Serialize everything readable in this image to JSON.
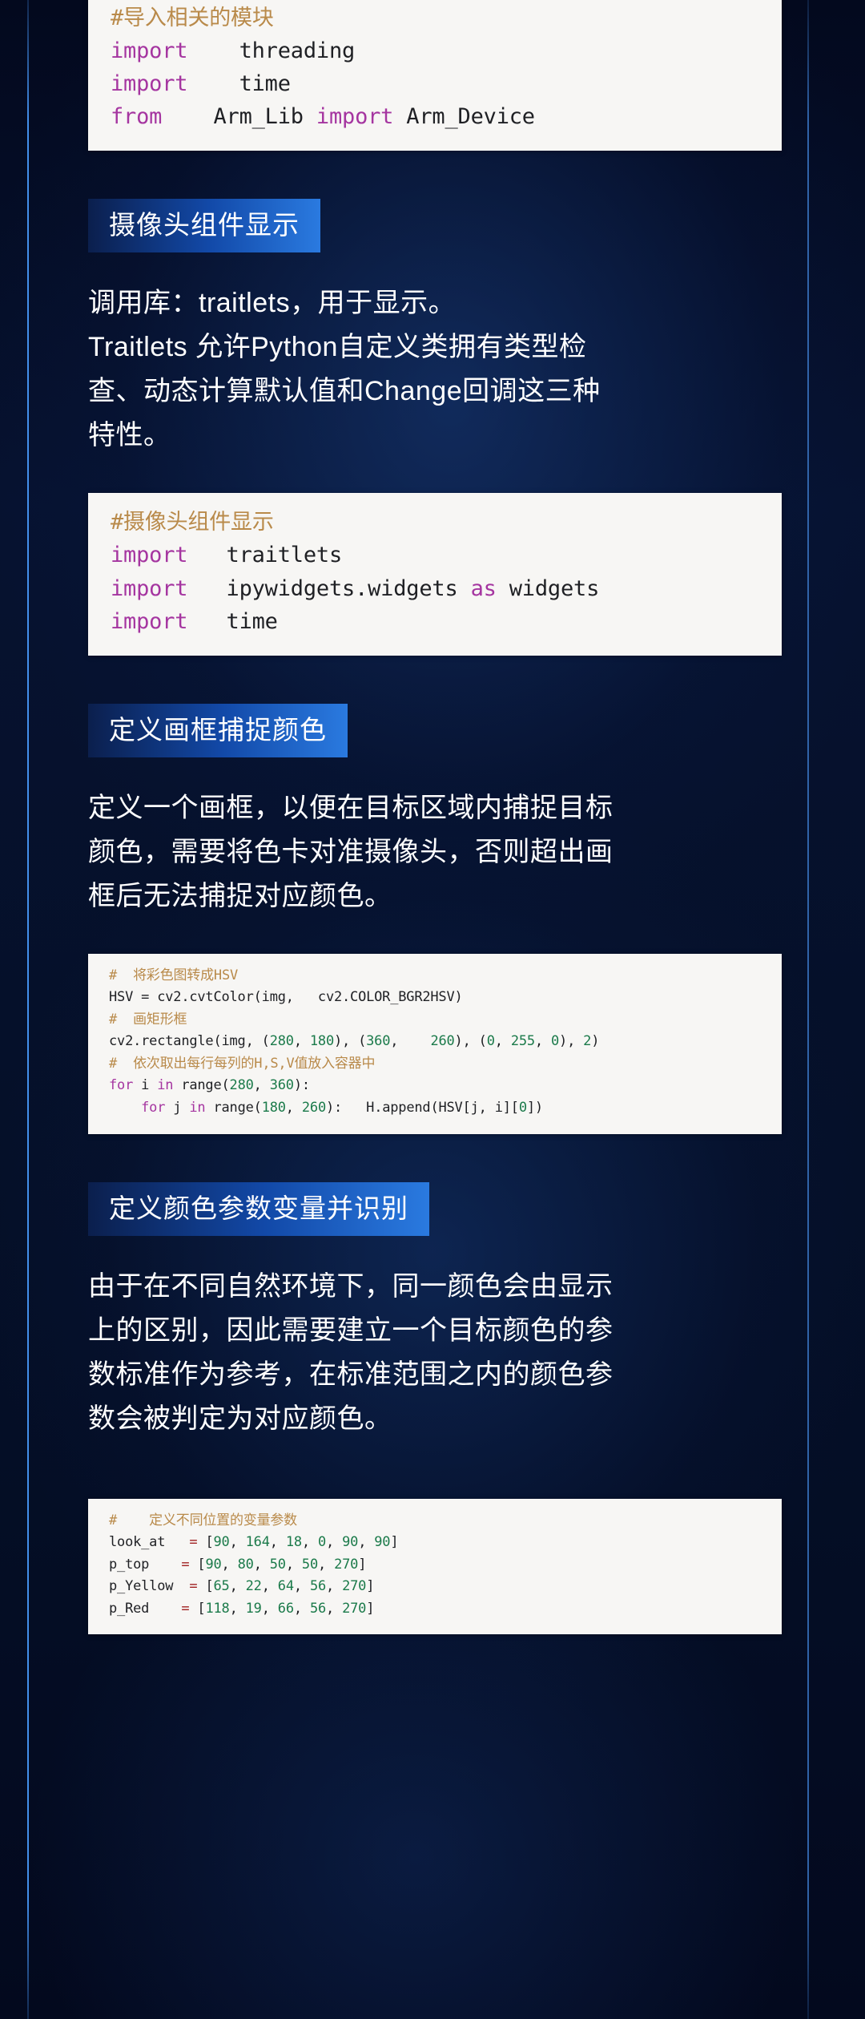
{
  "theme": {
    "page_bg": "#040d26",
    "rule_color": "#4696f5",
    "code_bg": "#f7f6f4",
    "header_gradient_start": "#0b1f4d",
    "header_gradient_end": "#2a7ae0",
    "text_color": "#ffffff",
    "comment_color": "#b98a4a",
    "keyword_color": "#a535a0",
    "number_color": "#1b7a4a",
    "operator_color": "#a02020"
  },
  "blocks": {
    "code_imports": {
      "lines": [
        {
          "parts": [
            {
              "t": "#导入相关的模块",
              "c": "cmt"
            }
          ]
        },
        {
          "parts": [
            {
              "t": "import",
              "c": "kw"
            },
            {
              "t": "    threading",
              "c": "txt"
            }
          ]
        },
        {
          "parts": [
            {
              "t": "import",
              "c": "kw"
            },
            {
              "t": "    time",
              "c": "txt"
            }
          ]
        },
        {
          "parts": [
            {
              "t": "from",
              "c": "kw"
            },
            {
              "t": "    Arm_Lib ",
              "c": "txt"
            },
            {
              "t": "import",
              "c": "kw"
            },
            {
              "t": " Arm_Device",
              "c": "txt"
            }
          ]
        }
      ]
    },
    "section_camera": {
      "heading": "摄像头组件显示",
      "paragraph": [
        "调用库：traitlets，用于显示。",
        "Traitlets 允许Python自定义类拥有类型检",
        "查、动态计算默认值和Change回调这三种",
        "特性。"
      ],
      "code": {
        "lines": [
          {
            "parts": [
              {
                "t": "#摄像头组件显示",
                "c": "cmt"
              }
            ]
          },
          {
            "parts": [
              {
                "t": "import",
                "c": "kw"
              },
              {
                "t": "   traitlets",
                "c": "txt"
              }
            ]
          },
          {
            "parts": [
              {
                "t": "import",
                "c": "kw"
              },
              {
                "t": "   ipywidgets.widgets ",
                "c": "txt"
              },
              {
                "t": "as",
                "c": "kw"
              },
              {
                "t": " widgets",
                "c": "txt"
              }
            ]
          },
          {
            "parts": [
              {
                "t": "import",
                "c": "kw"
              },
              {
                "t": "   time",
                "c": "txt"
              }
            ]
          }
        ]
      }
    },
    "section_frame": {
      "heading": "定义画框捕捉颜色",
      "paragraph": [
        "定义一个画框，以便在目标区域内捕捉目标",
        "颜色，需要将色卡对准摄像头，否则超出画",
        "框后无法捕捉对应颜色。"
      ],
      "code": {
        "lines": [
          {
            "parts": [
              {
                "t": "#  将彩色图转成HSV",
                "c": "cmt"
              }
            ]
          },
          {
            "parts": [
              {
                "t": "HSV = cv2.cvtColor(img,   cv2.COLOR_BGR2HSV)",
                "c": "txt"
              }
            ]
          },
          {
            "parts": [
              {
                "t": "#  画矩形框",
                "c": "cmt"
              }
            ]
          },
          {
            "parts": [
              {
                "t": "cv2.rectangle(img, (",
                "c": "txt"
              },
              {
                "t": "280",
                "c": "num"
              },
              {
                "t": ", ",
                "c": "txt"
              },
              {
                "t": "180",
                "c": "num"
              },
              {
                "t": "), (",
                "c": "txt"
              },
              {
                "t": "360",
                "c": "num"
              },
              {
                "t": ",    ",
                "c": "txt"
              },
              {
                "t": "260",
                "c": "num"
              },
              {
                "t": "), (",
                "c": "txt"
              },
              {
                "t": "0",
                "c": "num"
              },
              {
                "t": ", ",
                "c": "txt"
              },
              {
                "t": "255",
                "c": "num"
              },
              {
                "t": ", ",
                "c": "txt"
              },
              {
                "t": "0",
                "c": "num"
              },
              {
                "t": "), ",
                "c": "txt"
              },
              {
                "t": "2",
                "c": "num"
              },
              {
                "t": ")",
                "c": "txt"
              }
            ]
          },
          {
            "parts": [
              {
                "t": "#  依次取出每行每列的H,S,V值放入容器中",
                "c": "cmt"
              }
            ]
          },
          {
            "parts": [
              {
                "t": "for",
                "c": "kw"
              },
              {
                "t": " i ",
                "c": "txt"
              },
              {
                "t": "in",
                "c": "kw"
              },
              {
                "t": " range(",
                "c": "txt"
              },
              {
                "t": "280",
                "c": "num"
              },
              {
                "t": ", ",
                "c": "txt"
              },
              {
                "t": "360",
                "c": "num"
              },
              {
                "t": "):",
                "c": "txt"
              }
            ]
          },
          {
            "parts": [
              {
                "t": "    ",
                "c": "txt"
              },
              {
                "t": "for",
                "c": "kw"
              },
              {
                "t": " j ",
                "c": "txt"
              },
              {
                "t": "in",
                "c": "kw"
              },
              {
                "t": " range(",
                "c": "txt"
              },
              {
                "t": "180",
                "c": "num"
              },
              {
                "t": ", ",
                "c": "txt"
              },
              {
                "t": "260",
                "c": "num"
              },
              {
                "t": "):   H.append(HSV[j, i][",
                "c": "txt"
              },
              {
                "t": "0",
                "c": "num"
              },
              {
                "t": "])",
                "c": "txt"
              }
            ]
          }
        ]
      }
    },
    "section_color_params": {
      "heading": "定义颜色参数变量并识别",
      "paragraph": [
        "由于在不同自然环境下，同一颜色会由显示",
        "上的区别，因此需要建立一个目标颜色的参",
        "数标准作为参考，在标准范围之内的颜色参",
        "数会被判定为对应颜色。"
      ],
      "code": {
        "lines": [
          {
            "parts": [
              {
                "t": "#    定义不同位置的变量参数",
                "c": "cmt"
              }
            ]
          },
          {
            "parts": [
              {
                "t": "look_at   ",
                "c": "txt"
              },
              {
                "t": "=",
                "c": "op"
              },
              {
                "t": " [",
                "c": "txt"
              },
              {
                "t": "90",
                "c": "num"
              },
              {
                "t": ", ",
                "c": "txt"
              },
              {
                "t": "164",
                "c": "num"
              },
              {
                "t": ", ",
                "c": "txt"
              },
              {
                "t": "18",
                "c": "num"
              },
              {
                "t": ", ",
                "c": "txt"
              },
              {
                "t": "0",
                "c": "num"
              },
              {
                "t": ", ",
                "c": "txt"
              },
              {
                "t": "90",
                "c": "num"
              },
              {
                "t": ", ",
                "c": "txt"
              },
              {
                "t": "90",
                "c": "num"
              },
              {
                "t": "]",
                "c": "txt"
              }
            ]
          },
          {
            "parts": [
              {
                "t": "p_top    ",
                "c": "txt"
              },
              {
                "t": "=",
                "c": "op"
              },
              {
                "t": " [",
                "c": "txt"
              },
              {
                "t": "90",
                "c": "num"
              },
              {
                "t": ", ",
                "c": "txt"
              },
              {
                "t": "80",
                "c": "num"
              },
              {
                "t": ", ",
                "c": "txt"
              },
              {
                "t": "50",
                "c": "num"
              },
              {
                "t": ", ",
                "c": "txt"
              },
              {
                "t": "50",
                "c": "num"
              },
              {
                "t": ", ",
                "c": "txt"
              },
              {
                "t": "270",
                "c": "num"
              },
              {
                "t": "]",
                "c": "txt"
              }
            ]
          },
          {
            "parts": [
              {
                "t": "p_Yellow  ",
                "c": "txt"
              },
              {
                "t": "=",
                "c": "op"
              },
              {
                "t": " [",
                "c": "txt"
              },
              {
                "t": "65",
                "c": "num"
              },
              {
                "t": ", ",
                "c": "txt"
              },
              {
                "t": "22",
                "c": "num"
              },
              {
                "t": ", ",
                "c": "txt"
              },
              {
                "t": "64",
                "c": "num"
              },
              {
                "t": ", ",
                "c": "txt"
              },
              {
                "t": "56",
                "c": "num"
              },
              {
                "t": ", ",
                "c": "txt"
              },
              {
                "t": "270",
                "c": "num"
              },
              {
                "t": "]",
                "c": "txt"
              }
            ]
          },
          {
            "parts": [
              {
                "t": "p_Red    ",
                "c": "txt"
              },
              {
                "t": "=",
                "c": "op"
              },
              {
                "t": " [",
                "c": "txt"
              },
              {
                "t": "118",
                "c": "num"
              },
              {
                "t": ", ",
                "c": "txt"
              },
              {
                "t": "19",
                "c": "num"
              },
              {
                "t": ", ",
                "c": "txt"
              },
              {
                "t": "66",
                "c": "num"
              },
              {
                "t": ", ",
                "c": "txt"
              },
              {
                "t": "56",
                "c": "num"
              },
              {
                "t": ", ",
                "c": "txt"
              },
              {
                "t": "270",
                "c": "num"
              },
              {
                "t": "]",
                "c": "txt"
              }
            ]
          }
        ]
      }
    }
  }
}
